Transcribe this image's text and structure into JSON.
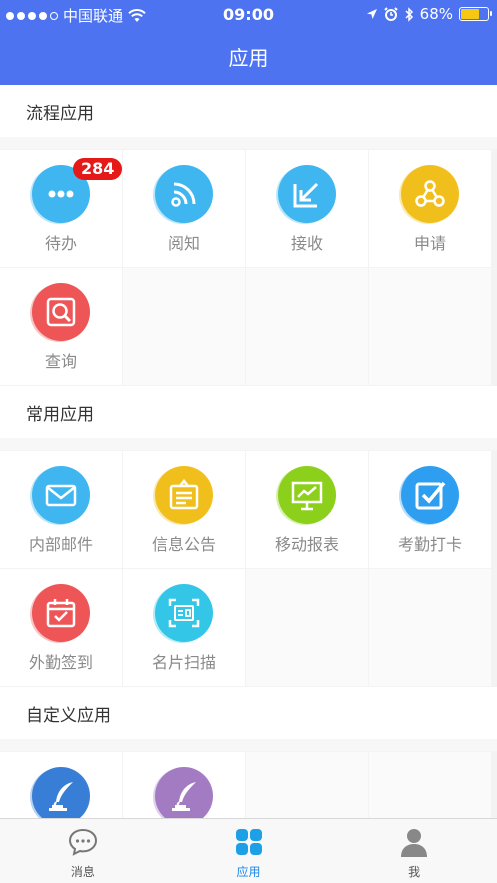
{
  "status_bar": {
    "carrier": "中国联通",
    "time": "09:00",
    "battery": "68%",
    "battery_level": 0.68
  },
  "nav": {
    "title": "应用"
  },
  "sections": [
    {
      "title": "流程应用",
      "items": [
        {
          "label": "待办",
          "icon": "more-dots-icon",
          "color": "#3fb6f0",
          "badge": "284"
        },
        {
          "label": "阅知",
          "icon": "rss-icon",
          "color": "#3fb6f0"
        },
        {
          "label": "接收",
          "icon": "receive-arrow-icon",
          "color": "#3fb6f0"
        },
        {
          "label": "申请",
          "icon": "share-nodes-icon",
          "color": "#f2bf1d"
        },
        {
          "label": "查询",
          "icon": "search-icon",
          "color": "#ee5557"
        }
      ]
    },
    {
      "title": "常用应用",
      "items": [
        {
          "label": "内部邮件",
          "icon": "mail-icon",
          "color": "#3fb6f0"
        },
        {
          "label": "信息公告",
          "icon": "notice-board-icon",
          "color": "#f2bf1d"
        },
        {
          "label": "移动报表",
          "icon": "chart-board-icon",
          "color": "#8cd01c"
        },
        {
          "label": "考勤打卡",
          "icon": "checkbox-icon",
          "color": "#2f9ff0"
        },
        {
          "label": "外勤签到",
          "icon": "calendar-check-icon",
          "color": "#ee5557"
        },
        {
          "label": "名片扫描",
          "icon": "card-scan-icon",
          "color": "#33c6e6"
        }
      ]
    },
    {
      "title": "自定义应用",
      "items": [
        {
          "label": "",
          "icon": "quill-ink-icon",
          "color": "#3a7fd6"
        },
        {
          "label": "",
          "icon": "quill-ink-icon",
          "color": "#a47cc4"
        }
      ]
    }
  ],
  "tabs": [
    {
      "label": "消息",
      "icon": "chat-bubble-icon",
      "active": false
    },
    {
      "label": "应用",
      "icon": "apps-grid-icon",
      "active": true
    },
    {
      "label": "我",
      "icon": "person-icon",
      "active": false
    }
  ],
  "colors": {
    "nav": "#4e73f1",
    "badge": "#e61919",
    "active_tab": "#1e88e5"
  }
}
